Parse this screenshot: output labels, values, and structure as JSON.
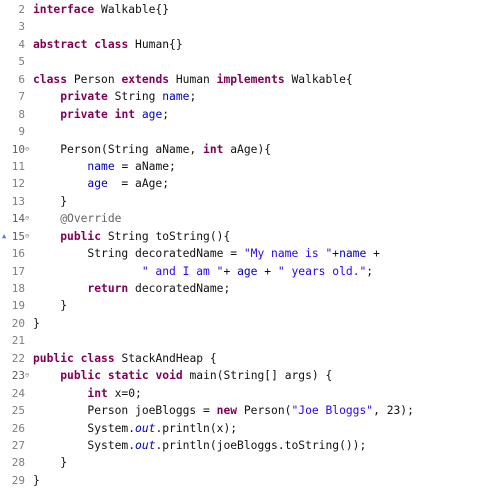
{
  "editor": {
    "lines": [
      {
        "num": "2",
        "marker": "",
        "tokens": [
          [
            "kw",
            "interface"
          ],
          [
            "plain",
            " Walkable{}"
          ]
        ]
      },
      {
        "num": "3",
        "marker": "",
        "tokens": []
      },
      {
        "num": "4",
        "marker": "",
        "tokens": [
          [
            "kw",
            "abstract"
          ],
          [
            "plain",
            " "
          ],
          [
            "kw",
            "class"
          ],
          [
            "plain",
            " Human{}"
          ]
        ]
      },
      {
        "num": "5",
        "marker": "",
        "tokens": []
      },
      {
        "num": "6",
        "marker": "",
        "tokens": [
          [
            "kw",
            "class"
          ],
          [
            "plain",
            " Person "
          ],
          [
            "kw",
            "extends"
          ],
          [
            "plain",
            " Human "
          ],
          [
            "kw",
            "implements"
          ],
          [
            "plain",
            " Walkable{"
          ]
        ]
      },
      {
        "num": "7",
        "marker": "",
        "tokens": [
          [
            "plain",
            "    "
          ],
          [
            "kw",
            "private"
          ],
          [
            "plain",
            " String "
          ],
          [
            "fld",
            "name"
          ],
          [
            "plain",
            ";"
          ]
        ]
      },
      {
        "num": "8",
        "marker": "",
        "tokens": [
          [
            "plain",
            "    "
          ],
          [
            "kw",
            "private"
          ],
          [
            "plain",
            " "
          ],
          [
            "kw",
            "int"
          ],
          [
            "plain",
            " "
          ],
          [
            "fld",
            "age"
          ],
          [
            "plain",
            ";"
          ]
        ]
      },
      {
        "num": "9",
        "marker": "",
        "tokens": []
      },
      {
        "num": "10",
        "marker": "fold",
        "tokens": [
          [
            "plain",
            "    Person(String aName, "
          ],
          [
            "kw",
            "int"
          ],
          [
            "plain",
            " aAge){"
          ]
        ]
      },
      {
        "num": "11",
        "marker": "",
        "tokens": [
          [
            "plain",
            "        "
          ],
          [
            "fld",
            "name"
          ],
          [
            "plain",
            " = aName;"
          ]
        ]
      },
      {
        "num": "12",
        "marker": "",
        "tokens": [
          [
            "plain",
            "        "
          ],
          [
            "fld",
            "age"
          ],
          [
            "plain",
            "  = aAge;"
          ]
        ]
      },
      {
        "num": "13",
        "marker": "",
        "tokens": [
          [
            "plain",
            "    }"
          ]
        ]
      },
      {
        "num": "14",
        "marker": "fold",
        "tokens": [
          [
            "plain",
            "    "
          ],
          [
            "ann",
            "@Override"
          ]
        ]
      },
      {
        "num": "15",
        "marker": "override",
        "tokens": [
          [
            "plain",
            "    "
          ],
          [
            "kw",
            "public"
          ],
          [
            "plain",
            " String toString(){"
          ]
        ]
      },
      {
        "num": "16",
        "marker": "",
        "tokens": [
          [
            "plain",
            "        String decoratedName = "
          ],
          [
            "str",
            "\"My name is \""
          ],
          [
            "plain",
            "+"
          ],
          [
            "fld",
            "name"
          ],
          [
            "plain",
            " +"
          ]
        ]
      },
      {
        "num": "17",
        "marker": "",
        "tokens": [
          [
            "plain",
            "                "
          ],
          [
            "str",
            "\" and I am \""
          ],
          [
            "plain",
            "+ "
          ],
          [
            "fld",
            "age"
          ],
          [
            "plain",
            " + "
          ],
          [
            "str",
            "\" years old.\""
          ],
          [
            "plain",
            ";"
          ]
        ]
      },
      {
        "num": "18",
        "marker": "",
        "tokens": [
          [
            "plain",
            "        "
          ],
          [
            "kw",
            "return"
          ],
          [
            "plain",
            " decoratedName;"
          ]
        ]
      },
      {
        "num": "19",
        "marker": "",
        "tokens": [
          [
            "plain",
            "    }"
          ]
        ]
      },
      {
        "num": "20",
        "marker": "",
        "tokens": [
          [
            "plain",
            "}"
          ]
        ]
      },
      {
        "num": "21",
        "marker": "",
        "tokens": []
      },
      {
        "num": "22",
        "marker": "",
        "tokens": [
          [
            "kw",
            "public"
          ],
          [
            "plain",
            " "
          ],
          [
            "kw",
            "class"
          ],
          [
            "plain",
            " StackAndHeap {"
          ]
        ]
      },
      {
        "num": "23",
        "marker": "fold",
        "tokens": [
          [
            "plain",
            "    "
          ],
          [
            "kw",
            "public"
          ],
          [
            "plain",
            " "
          ],
          [
            "kw",
            "static"
          ],
          [
            "plain",
            " "
          ],
          [
            "kw",
            "void"
          ],
          [
            "plain",
            " main(String[] args) {"
          ]
        ]
      },
      {
        "num": "24",
        "marker": "",
        "tokens": [
          [
            "plain",
            "        "
          ],
          [
            "kw",
            "int"
          ],
          [
            "plain",
            " x=0;"
          ]
        ]
      },
      {
        "num": "25",
        "marker": "",
        "tokens": [
          [
            "plain",
            "        Person joeBloggs = "
          ],
          [
            "kw",
            "new"
          ],
          [
            "plain",
            " Person("
          ],
          [
            "str",
            "\"Joe Bloggs\""
          ],
          [
            "plain",
            ", 23);"
          ]
        ]
      },
      {
        "num": "26",
        "marker": "",
        "tokens": [
          [
            "plain",
            "        System."
          ],
          [
            "stat",
            "out"
          ],
          [
            "plain",
            ".println(x);"
          ]
        ]
      },
      {
        "num": "27",
        "marker": "",
        "tokens": [
          [
            "plain",
            "        System."
          ],
          [
            "stat",
            "out"
          ],
          [
            "plain",
            ".println(joeBloggs.toString());"
          ]
        ]
      },
      {
        "num": "28",
        "marker": "",
        "tokens": [
          [
            "plain",
            "    }"
          ]
        ]
      },
      {
        "num": "29",
        "marker": "",
        "tokens": [
          [
            "plain",
            "}"
          ]
        ]
      }
    ],
    "glyphs": {
      "fold": "⊖",
      "override": "▲"
    },
    "colors": {
      "keyword": "#7f0055",
      "field": "#0000c0",
      "string": "#2a00ff",
      "annotation": "#646464",
      "line_number": "#7d7d7d"
    }
  }
}
